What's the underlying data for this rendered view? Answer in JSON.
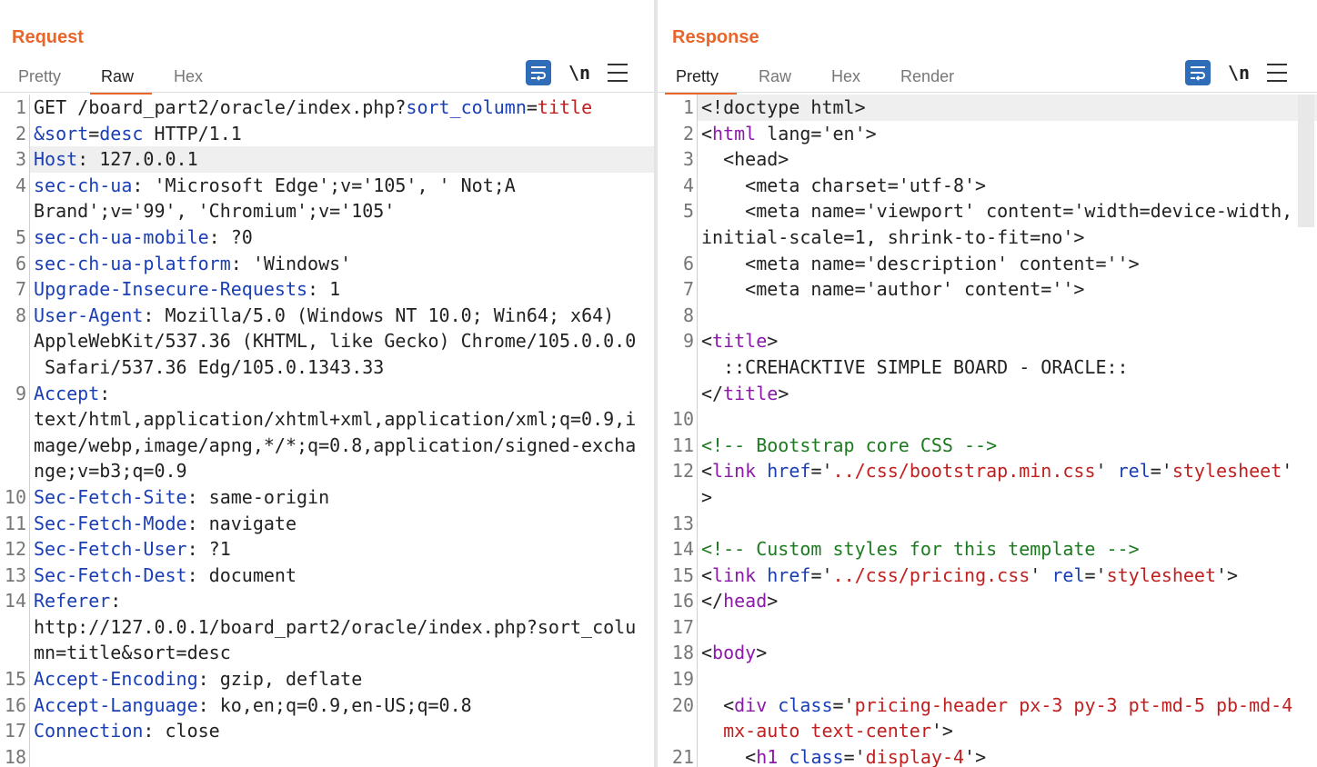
{
  "request": {
    "title": "Request",
    "tabs": [
      "Pretty",
      "Raw",
      "Hex"
    ],
    "active_tab": "Raw",
    "tools": {
      "newline_label": "\\n"
    },
    "lines": [
      {
        "n": "1",
        "segs": [
          [
            "p",
            "GET /board_part2/oracle/index.php?"
          ],
          [
            "k",
            "sort_column"
          ],
          [
            "p",
            "="
          ],
          [
            "v",
            "title"
          ]
        ]
      },
      {
        "n": "2",
        "segs": [
          [
            "k",
            "&sort"
          ],
          [
            "p",
            "="
          ],
          [
            "k",
            "desc"
          ],
          [
            "p",
            " HTTP/1.1"
          ]
        ]
      },
      {
        "n": "3",
        "hl": true,
        "segs": [
          [
            "k",
            "Host"
          ],
          [
            "p",
            ": 127.0.0.1"
          ]
        ]
      },
      {
        "n": "4",
        "segs": [
          [
            "k",
            "sec-ch-ua"
          ],
          [
            "p",
            ": 'Microsoft Edge';v='105', ' Not;A"
          ]
        ]
      },
      {
        "n": "",
        "segs": [
          [
            "p",
            "Brand';v='99', 'Chromium';v='105'"
          ]
        ]
      },
      {
        "n": "5",
        "segs": [
          [
            "k",
            "sec-ch-ua-mobile"
          ],
          [
            "p",
            ": ?0"
          ]
        ]
      },
      {
        "n": "6",
        "segs": [
          [
            "k",
            "sec-ch-ua-platform"
          ],
          [
            "p",
            ": 'Windows'"
          ]
        ]
      },
      {
        "n": "7",
        "segs": [
          [
            "k",
            "Upgrade-Insecure-Requests"
          ],
          [
            "p",
            ": 1"
          ]
        ]
      },
      {
        "n": "8",
        "segs": [
          [
            "k",
            "User-Agent"
          ],
          [
            "p",
            ": Mozilla/5.0 (Windows NT 10.0; Win64; x64)"
          ]
        ]
      },
      {
        "n": "",
        "segs": [
          [
            "p",
            "AppleWebKit/537.36 (KHTML, like Gecko) Chrome/105.0.0.0"
          ]
        ]
      },
      {
        "n": "",
        "segs": [
          [
            "p",
            " Safari/537.36 Edg/105.0.1343.33"
          ]
        ]
      },
      {
        "n": "9",
        "segs": [
          [
            "k",
            "Accept"
          ],
          [
            "p",
            ":"
          ]
        ]
      },
      {
        "n": "",
        "segs": [
          [
            "p",
            "text/html,application/xhtml+xml,application/xml;q=0.9,i"
          ]
        ]
      },
      {
        "n": "",
        "segs": [
          [
            "p",
            "mage/webp,image/apng,*/*;q=0.8,application/signed-excha"
          ]
        ]
      },
      {
        "n": "",
        "segs": [
          [
            "p",
            "nge;v=b3;q=0.9"
          ]
        ]
      },
      {
        "n": "10",
        "segs": [
          [
            "k",
            "Sec-Fetch-Site"
          ],
          [
            "p",
            ": same-origin"
          ]
        ]
      },
      {
        "n": "11",
        "segs": [
          [
            "k",
            "Sec-Fetch-Mode"
          ],
          [
            "p",
            ": navigate"
          ]
        ]
      },
      {
        "n": "12",
        "segs": [
          [
            "k",
            "Sec-Fetch-User"
          ],
          [
            "p",
            ": ?1"
          ]
        ]
      },
      {
        "n": "13",
        "segs": [
          [
            "k",
            "Sec-Fetch-Dest"
          ],
          [
            "p",
            ": document"
          ]
        ]
      },
      {
        "n": "14",
        "segs": [
          [
            "k",
            "Referer"
          ],
          [
            "p",
            ":"
          ]
        ]
      },
      {
        "n": "",
        "segs": [
          [
            "p",
            "http://127.0.0.1/board_part2/oracle/index.php?sort_colu"
          ]
        ]
      },
      {
        "n": "",
        "segs": [
          [
            "p",
            "mn=title&sort=desc"
          ]
        ]
      },
      {
        "n": "15",
        "segs": [
          [
            "k",
            "Accept-Encoding"
          ],
          [
            "p",
            ": gzip, deflate"
          ]
        ]
      },
      {
        "n": "16",
        "segs": [
          [
            "k",
            "Accept-Language"
          ],
          [
            "p",
            ": ko,en;q=0.9,en-US;q=0.8"
          ]
        ]
      },
      {
        "n": "17",
        "segs": [
          [
            "k",
            "Connection"
          ],
          [
            "p",
            ": close"
          ]
        ]
      },
      {
        "n": "18",
        "segs": [
          [
            "p",
            ""
          ]
        ]
      }
    ]
  },
  "response": {
    "title": "Response",
    "tabs": [
      "Pretty",
      "Raw",
      "Hex",
      "Render"
    ],
    "active_tab": "Pretty",
    "tools": {
      "newline_label": "\\n"
    },
    "lines": [
      {
        "n": "1",
        "hl": true,
        "segs": [
          [
            "p",
            "<!doctype html>"
          ]
        ]
      },
      {
        "n": "2",
        "segs": [
          [
            "p",
            "<"
          ],
          [
            "t",
            "html"
          ],
          [
            "p",
            " lang='en'>"
          ]
        ]
      },
      {
        "n": "3",
        "segs": [
          [
            "p",
            "  <head>"
          ]
        ]
      },
      {
        "n": "4",
        "segs": [
          [
            "p",
            "    <meta charset='utf-8'>"
          ]
        ]
      },
      {
        "n": "5",
        "segs": [
          [
            "p",
            "    <meta name='viewport' content='width=device-width,"
          ]
        ]
      },
      {
        "n": "",
        "segs": [
          [
            "p",
            "initial-scale=1, shrink-to-fit=no'>"
          ]
        ]
      },
      {
        "n": "6",
        "segs": [
          [
            "p",
            "    <meta name='description' content=''>"
          ]
        ]
      },
      {
        "n": "7",
        "segs": [
          [
            "p",
            "    <meta name='author' content=''>"
          ]
        ]
      },
      {
        "n": "8",
        "segs": [
          [
            "p",
            ""
          ]
        ]
      },
      {
        "n": "9",
        "segs": [
          [
            "p",
            "<"
          ],
          [
            "t",
            "title"
          ],
          [
            "p",
            ">"
          ]
        ]
      },
      {
        "n": "",
        "segs": [
          [
            "p",
            "  ::CREHACKTIVE SIMPLE BOARD - ORACLE::"
          ]
        ]
      },
      {
        "n": "",
        "segs": [
          [
            "p",
            "</"
          ],
          [
            "t",
            "title"
          ],
          [
            "p",
            ">"
          ]
        ]
      },
      {
        "n": "10",
        "segs": [
          [
            "p",
            ""
          ]
        ]
      },
      {
        "n": "11",
        "segs": [
          [
            "c",
            "<!-- Bootstrap core CSS -->"
          ]
        ]
      },
      {
        "n": "12",
        "segs": [
          [
            "p",
            "<"
          ],
          [
            "t",
            "link"
          ],
          [
            "p",
            " "
          ],
          [
            "k",
            "href"
          ],
          [
            "p",
            "='"
          ],
          [
            "v",
            "../css/bootstrap.min.css"
          ],
          [
            "p",
            "' "
          ],
          [
            "k",
            "rel"
          ],
          [
            "p",
            "='"
          ],
          [
            "v",
            "stylesheet"
          ],
          [
            "p",
            "'"
          ]
        ]
      },
      {
        "n": "",
        "segs": [
          [
            "p",
            ">"
          ]
        ]
      },
      {
        "n": "13",
        "segs": [
          [
            "p",
            ""
          ]
        ]
      },
      {
        "n": "14",
        "segs": [
          [
            "c",
            "<!-- Custom styles for this template -->"
          ]
        ]
      },
      {
        "n": "15",
        "segs": [
          [
            "p",
            "<"
          ],
          [
            "t",
            "link"
          ],
          [
            "p",
            " "
          ],
          [
            "k",
            "href"
          ],
          [
            "p",
            "='"
          ],
          [
            "v",
            "../css/pricing.css"
          ],
          [
            "p",
            "' "
          ],
          [
            "k",
            "rel"
          ],
          [
            "p",
            "='"
          ],
          [
            "v",
            "stylesheet"
          ],
          [
            "p",
            "'>"
          ]
        ]
      },
      {
        "n": "16",
        "segs": [
          [
            "p",
            "</"
          ],
          [
            "t",
            "head"
          ],
          [
            "p",
            ">"
          ]
        ]
      },
      {
        "n": "17",
        "segs": [
          [
            "p",
            ""
          ]
        ]
      },
      {
        "n": "18",
        "segs": [
          [
            "p",
            "<"
          ],
          [
            "t",
            "body"
          ],
          [
            "p",
            ">"
          ]
        ]
      },
      {
        "n": "19",
        "segs": [
          [
            "p",
            ""
          ]
        ]
      },
      {
        "n": "20",
        "segs": [
          [
            "p",
            "  <"
          ],
          [
            "t",
            "div"
          ],
          [
            "p",
            " "
          ],
          [
            "k",
            "class"
          ],
          [
            "p",
            "='"
          ],
          [
            "v",
            "pricing-header px-3 py-3 pt-md-5 pb-md-4"
          ]
        ]
      },
      {
        "n": "",
        "segs": [
          [
            "v",
            "  mx-auto text-center"
          ],
          [
            "p",
            "'>"
          ]
        ]
      },
      {
        "n": "21",
        "segs": [
          [
            "p",
            "    <"
          ],
          [
            "t",
            "h1"
          ],
          [
            "p",
            " "
          ],
          [
            "k",
            "class"
          ],
          [
            "p",
            "='"
          ],
          [
            "v",
            "display-4"
          ],
          [
            "p",
            "'>"
          ]
        ]
      }
    ]
  }
}
